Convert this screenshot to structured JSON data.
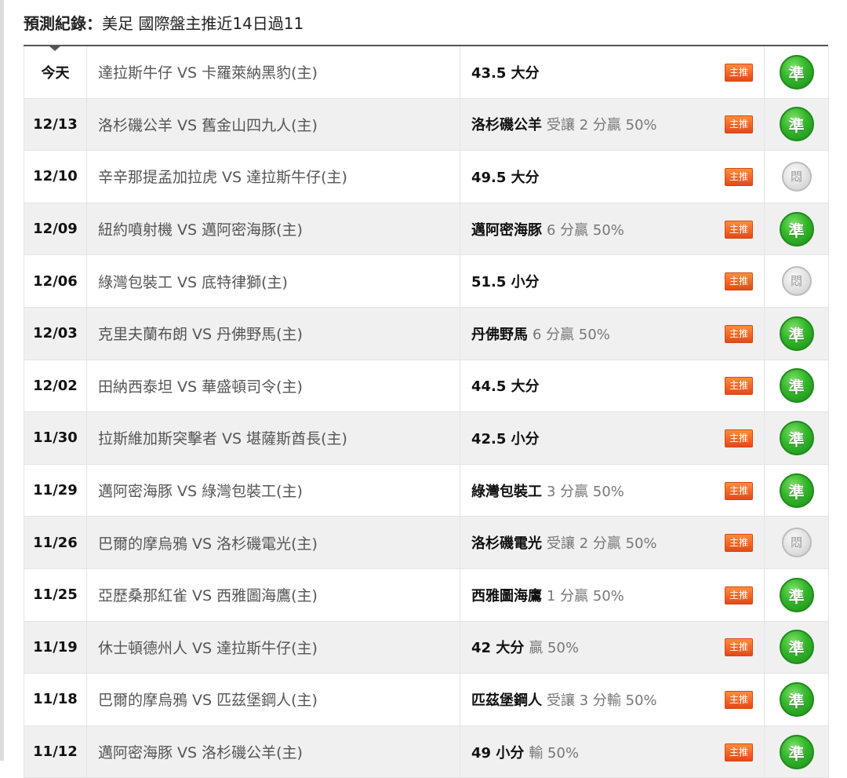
{
  "header": {
    "label": "預測紀錄：",
    "title": "美足 國際盤主推近14日過11"
  },
  "badge_label": "主推",
  "rows": [
    {
      "date": "今天",
      "match": "達拉斯牛仔 VS 卡羅萊納黑豹(主)",
      "pick": "43.5 大分",
      "detail": "",
      "result": "準"
    },
    {
      "date": "12/13",
      "match": "洛杉磯公羊 VS 舊金山四九人(主)",
      "pick": "洛杉磯公羊",
      "detail": "受讓 2 分贏 50%",
      "result": "準"
    },
    {
      "date": "12/10",
      "match": "辛辛那提孟加拉虎 VS 達拉斯牛仔(主)",
      "pick": "49.5 大分",
      "detail": "",
      "result": "悶"
    },
    {
      "date": "12/09",
      "match": "紐約噴射機 VS 邁阿密海豚(主)",
      "pick": "邁阿密海豚",
      "detail": "6 分贏 50%",
      "result": "準"
    },
    {
      "date": "12/06",
      "match": "綠灣包裝工 VS 底特律獅(主)",
      "pick": "51.5 小分",
      "detail": "",
      "result": "悶"
    },
    {
      "date": "12/03",
      "match": "克里夫蘭布朗 VS 丹佛野馬(主)",
      "pick": "丹佛野馬",
      "detail": "6 分贏 50%",
      "result": "準"
    },
    {
      "date": "12/02",
      "match": "田納西泰坦 VS 華盛頓司令(主)",
      "pick": "44.5 大分",
      "detail": "",
      "result": "準"
    },
    {
      "date": "11/30",
      "match": "拉斯維加斯突擊者 VS 堪薩斯酋長(主)",
      "pick": "42.5 小分",
      "detail": "",
      "result": "準"
    },
    {
      "date": "11/29",
      "match": "邁阿密海豚 VS 綠灣包裝工(主)",
      "pick": "綠灣包裝工",
      "detail": "3 分贏 50%",
      "result": "準"
    },
    {
      "date": "11/26",
      "match": "巴爾的摩烏鴉 VS 洛杉磯電光(主)",
      "pick": "洛杉磯電光",
      "detail": "受讓 2 分贏 50%",
      "result": "悶"
    },
    {
      "date": "11/25",
      "match": "亞歷桑那紅雀 VS 西雅圖海鷹(主)",
      "pick": "西雅圖海鷹",
      "detail": "1 分贏 50%",
      "result": "準"
    },
    {
      "date": "11/19",
      "match": "休士頓德州人 VS 達拉斯牛仔(主)",
      "pick": "42 大分",
      "detail": "贏 50%",
      "result": "準"
    },
    {
      "date": "11/18",
      "match": "巴爾的摩烏鴉 VS 匹茲堡鋼人(主)",
      "pick": "匹茲堡鋼人",
      "detail": "受讓 3 分輸 50%",
      "result": "準"
    },
    {
      "date": "11/12",
      "match": "邁阿密海豚 VS 洛杉磯公羊(主)",
      "pick": "49 小分",
      "detail": "輸 50%",
      "result": "準"
    }
  ],
  "colors": {
    "hit": "#2ea12a",
    "miss": "#c8c8c8",
    "badge": "#e85c20"
  }
}
